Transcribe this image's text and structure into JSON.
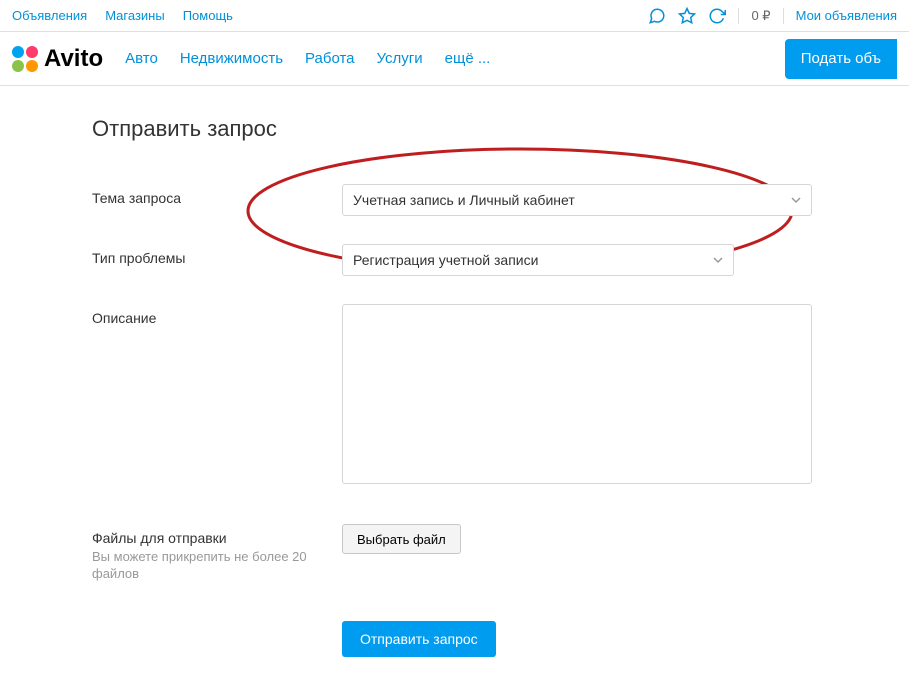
{
  "topbar": {
    "links": [
      "Объявления",
      "Магазины",
      "Помощь"
    ],
    "balance": "0 ₽",
    "my_ads": "Мои объявления"
  },
  "logo": {
    "text": "Avito"
  },
  "nav": {
    "items": [
      "Авто",
      "Недвижимость",
      "Работа",
      "Услуги",
      "ещё ..."
    ]
  },
  "post_button": "Подать объ",
  "page": {
    "title": "Отправить запрос"
  },
  "form": {
    "topic_label": "Тема запроса",
    "topic_value": "Учетная запись и Личный кабинет",
    "problem_label": "Тип проблемы",
    "problem_value": "Регистрация учетной записи",
    "description_label": "Описание",
    "files_label": "Файлы для отправки",
    "files_hint": "Вы можете прикрепить не более 20 файлов",
    "choose_file": "Выбрать файл",
    "submit": "Отправить запрос"
  }
}
